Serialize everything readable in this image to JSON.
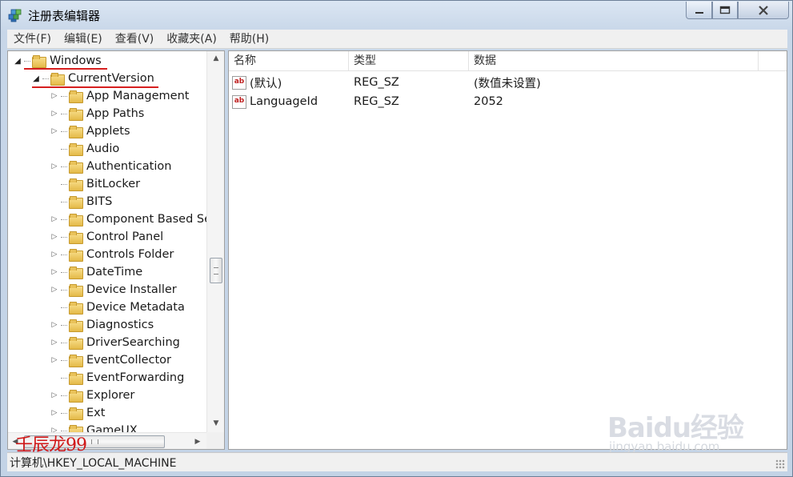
{
  "window": {
    "title": "注册表编辑器",
    "buttons": {
      "minimize": "—",
      "maximize": "☐",
      "close": "✕"
    }
  },
  "menu": [
    {
      "label": "文件(F)"
    },
    {
      "label": "编辑(E)"
    },
    {
      "label": "查看(V)"
    },
    {
      "label": "收藏夹(A)"
    },
    {
      "label": "帮助(H)"
    }
  ],
  "tree": {
    "items": [
      {
        "label": "Windows",
        "level": 0,
        "expanded": true
      },
      {
        "label": "CurrentVersion",
        "level": 1,
        "expanded": true
      },
      {
        "label": "App Management",
        "level": 2,
        "has_children": true
      },
      {
        "label": "App Paths",
        "level": 2,
        "has_children": true
      },
      {
        "label": "Applets",
        "level": 2,
        "has_children": true
      },
      {
        "label": "Audio",
        "level": 2,
        "has_children": false
      },
      {
        "label": "Authentication",
        "level": 2,
        "has_children": true
      },
      {
        "label": "BitLocker",
        "level": 2,
        "has_children": false
      },
      {
        "label": "BITS",
        "level": 2,
        "has_children": false
      },
      {
        "label": "Component Based Se",
        "level": 2,
        "has_children": true
      },
      {
        "label": "Control Panel",
        "level": 2,
        "has_children": true
      },
      {
        "label": "Controls Folder",
        "level": 2,
        "has_children": true
      },
      {
        "label": "DateTime",
        "level": 2,
        "has_children": true
      },
      {
        "label": "Device Installer",
        "level": 2,
        "has_children": true
      },
      {
        "label": "Device Metadata",
        "level": 2,
        "has_children": false
      },
      {
        "label": "Diagnostics",
        "level": 2,
        "has_children": true
      },
      {
        "label": "DriverSearching",
        "level": 2,
        "has_children": true
      },
      {
        "label": "EventCollector",
        "level": 2,
        "has_children": true
      },
      {
        "label": "EventForwarding",
        "level": 2,
        "has_children": false
      },
      {
        "label": "Explorer",
        "level": 2,
        "has_children": true
      },
      {
        "label": "Ext",
        "level": 2,
        "has_children": true
      },
      {
        "label": "GameUX",
        "level": 2,
        "has_children": true
      }
    ]
  },
  "list": {
    "columns": [
      "名称",
      "类型",
      "数据"
    ],
    "rows": [
      {
        "name": "(默认)",
        "type": "REG_SZ",
        "data": "(数值未设置)"
      },
      {
        "name": "LanguageId",
        "type": "REG_SZ",
        "data": "2052"
      }
    ]
  },
  "status": {
    "path": "计算机\\HKEY_LOCAL_MACHINE"
  },
  "overlay": {
    "author_mark": "壬辰龙99",
    "baidu_mark": "Baidu经验",
    "baidu_url": "jingyan.baidu.com"
  },
  "icons": {
    "tree_folder": "folder-icon",
    "value_string": "string-value-icon",
    "app": "registry-editor-icon"
  },
  "colors": {
    "annotation_red": "#d61f1f",
    "frame": "#c7d6e8"
  }
}
